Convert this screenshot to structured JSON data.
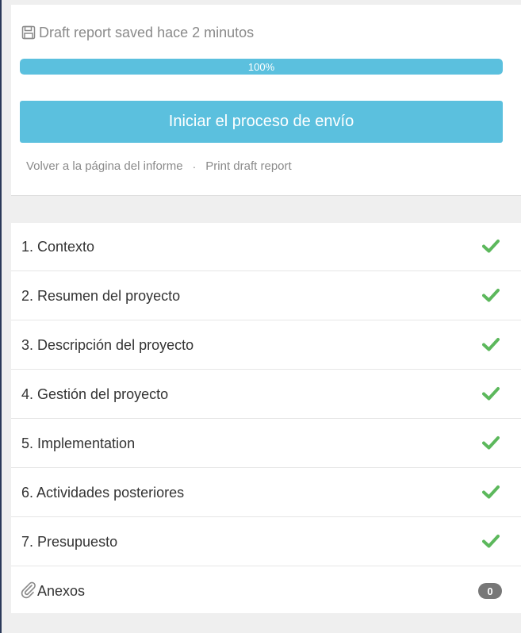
{
  "status": {
    "saved_text": "Draft report saved hace 2 minutos",
    "save_icon": "floppy-disk-icon"
  },
  "progress": {
    "value": 100,
    "label": "100%",
    "color": "#5bc0de"
  },
  "actions": {
    "submit_label": "Iniciar el proceso de envío",
    "back_link": "Volver a la página del informe",
    "separator": "·",
    "print_link": "Print draft report"
  },
  "sections": [
    {
      "label": "1. Contexto",
      "status": "complete",
      "icon": "check-icon"
    },
    {
      "label": "2. Resumen del proyecto",
      "status": "complete",
      "icon": "check-icon"
    },
    {
      "label": "3. Descripción del proyecto",
      "status": "complete",
      "icon": "check-icon"
    },
    {
      "label": "4. Gestión del proyecto",
      "status": "complete",
      "icon": "check-icon"
    },
    {
      "label": "5. Implementation",
      "status": "complete",
      "icon": "check-icon"
    },
    {
      "label": "6. Actividades posteriores",
      "status": "complete",
      "icon": "check-icon"
    },
    {
      "label": "7. Presupuesto",
      "status": "complete",
      "icon": "check-icon"
    }
  ],
  "attachments": {
    "label": "Anexos",
    "count": "0",
    "icon": "paperclip-icon"
  },
  "colors": {
    "accent": "#5bc0de",
    "check": "#5cb85c",
    "badge": "#777777"
  }
}
